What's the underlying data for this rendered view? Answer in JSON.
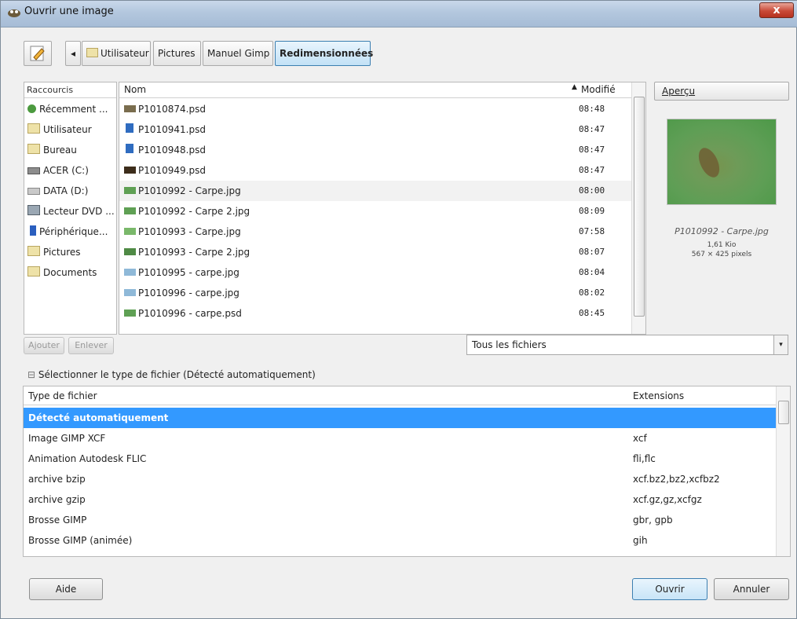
{
  "window": {
    "title": "Ouvrir une image",
    "close_glyph": "x"
  },
  "toolbar": {
    "edit_icon": "pencil-note-icon",
    "back_glyph": "◂",
    "path": [
      {
        "label": "Utilisateur",
        "active": false
      },
      {
        "label": "Pictures",
        "active": false
      },
      {
        "label": "Manuel Gimp",
        "active": false
      },
      {
        "label": "Redimensionnées",
        "active": true
      }
    ]
  },
  "places": {
    "header": "Raccourcis",
    "items": [
      {
        "label": "Récemment ...",
        "icon": "recent-icon"
      },
      {
        "label": "Utilisateur",
        "icon": "folder-icon"
      },
      {
        "label": "Bureau",
        "icon": "folder-icon"
      },
      {
        "label": "ACER (C:)",
        "icon": "drive-icon"
      },
      {
        "label": "DATA (D:)",
        "icon": "drive-icon"
      },
      {
        "label": "Lecteur DVD ...",
        "icon": "dvd-icon"
      },
      {
        "label": "Périphérique...",
        "icon": "device-icon"
      },
      {
        "label": "Pictures",
        "icon": "folder-icon"
      },
      {
        "label": "Documents",
        "icon": "folder-icon"
      }
    ],
    "add_label": "Ajouter",
    "remove_label": "Enlever"
  },
  "files": {
    "col_name": "Nom",
    "col_modified": "Modifié",
    "sort_indicator": "▲",
    "rows": [
      {
        "name": "P1010874.psd",
        "modified": "08:48",
        "thumb_color": "#7a6d4e"
      },
      {
        "name": "P1010941.psd",
        "modified": "08:47",
        "thumb_color": "#2f6cc0"
      },
      {
        "name": "P1010948.psd",
        "modified": "08:47",
        "thumb_color": "#2f6cc0"
      },
      {
        "name": "P1010949.psd",
        "modified": "08:47",
        "thumb_color": "#3d2d1b"
      },
      {
        "name": "P1010992 - Carpe.jpg",
        "modified": "08:00",
        "thumb_color": "#5fa054"
      },
      {
        "name": "P1010992 - Carpe 2.jpg",
        "modified": "08:09",
        "thumb_color": "#5fa054"
      },
      {
        "name": "P1010993 - Carpe.jpg",
        "modified": "07:58",
        "thumb_color": "#7ab86a"
      },
      {
        "name": "P1010993 - Carpe 2.jpg",
        "modified": "08:07",
        "thumb_color": "#4f8a45"
      },
      {
        "name": "P1010995 - carpe.jpg",
        "modified": "08:04",
        "thumb_color": "#8fb9d8"
      },
      {
        "name": "P1010996 - carpe.jpg",
        "modified": "08:02",
        "thumb_color": "#8fb9d8"
      },
      {
        "name": "P1010996 - carpe.psd",
        "modified": "08:45",
        "thumb_color": "#5fa054"
      }
    ]
  },
  "preview": {
    "header": "Aperçu",
    "filename": "P1010992 - Carpe.jpg",
    "size": "1,61 Kio",
    "dimensions": "567 × 425 pixels"
  },
  "filter": {
    "selected": "Tous les fichiers",
    "arrow_glyph": "▾"
  },
  "filetype": {
    "expander_glyph": "⊟",
    "expander_label": "Sélectionner le type de fichier (Détecté automatiquement)",
    "col_type": "Type de fichier",
    "col_ext": "Extensions",
    "rows": [
      {
        "type": "Détecté automatiquement",
        "ext": "",
        "selected": true
      },
      {
        "type": "Image GIMP XCF",
        "ext": "xcf"
      },
      {
        "type": "Animation Autodesk FLIC",
        "ext": "fli,flc"
      },
      {
        "type": "archive bzip",
        "ext": "xcf.bz2,bz2,xcfbz2"
      },
      {
        "type": "archive gzip",
        "ext": "xcf.gz,gz,xcfgz"
      },
      {
        "type": "Brosse GIMP",
        "ext": "gbr, gpb"
      },
      {
        "type": "Brosse GIMP (animée)",
        "ext": "gih"
      }
    ]
  },
  "footer": {
    "help_label": "Aide",
    "open_label": "Ouvrir",
    "cancel_label": "Annuler"
  }
}
